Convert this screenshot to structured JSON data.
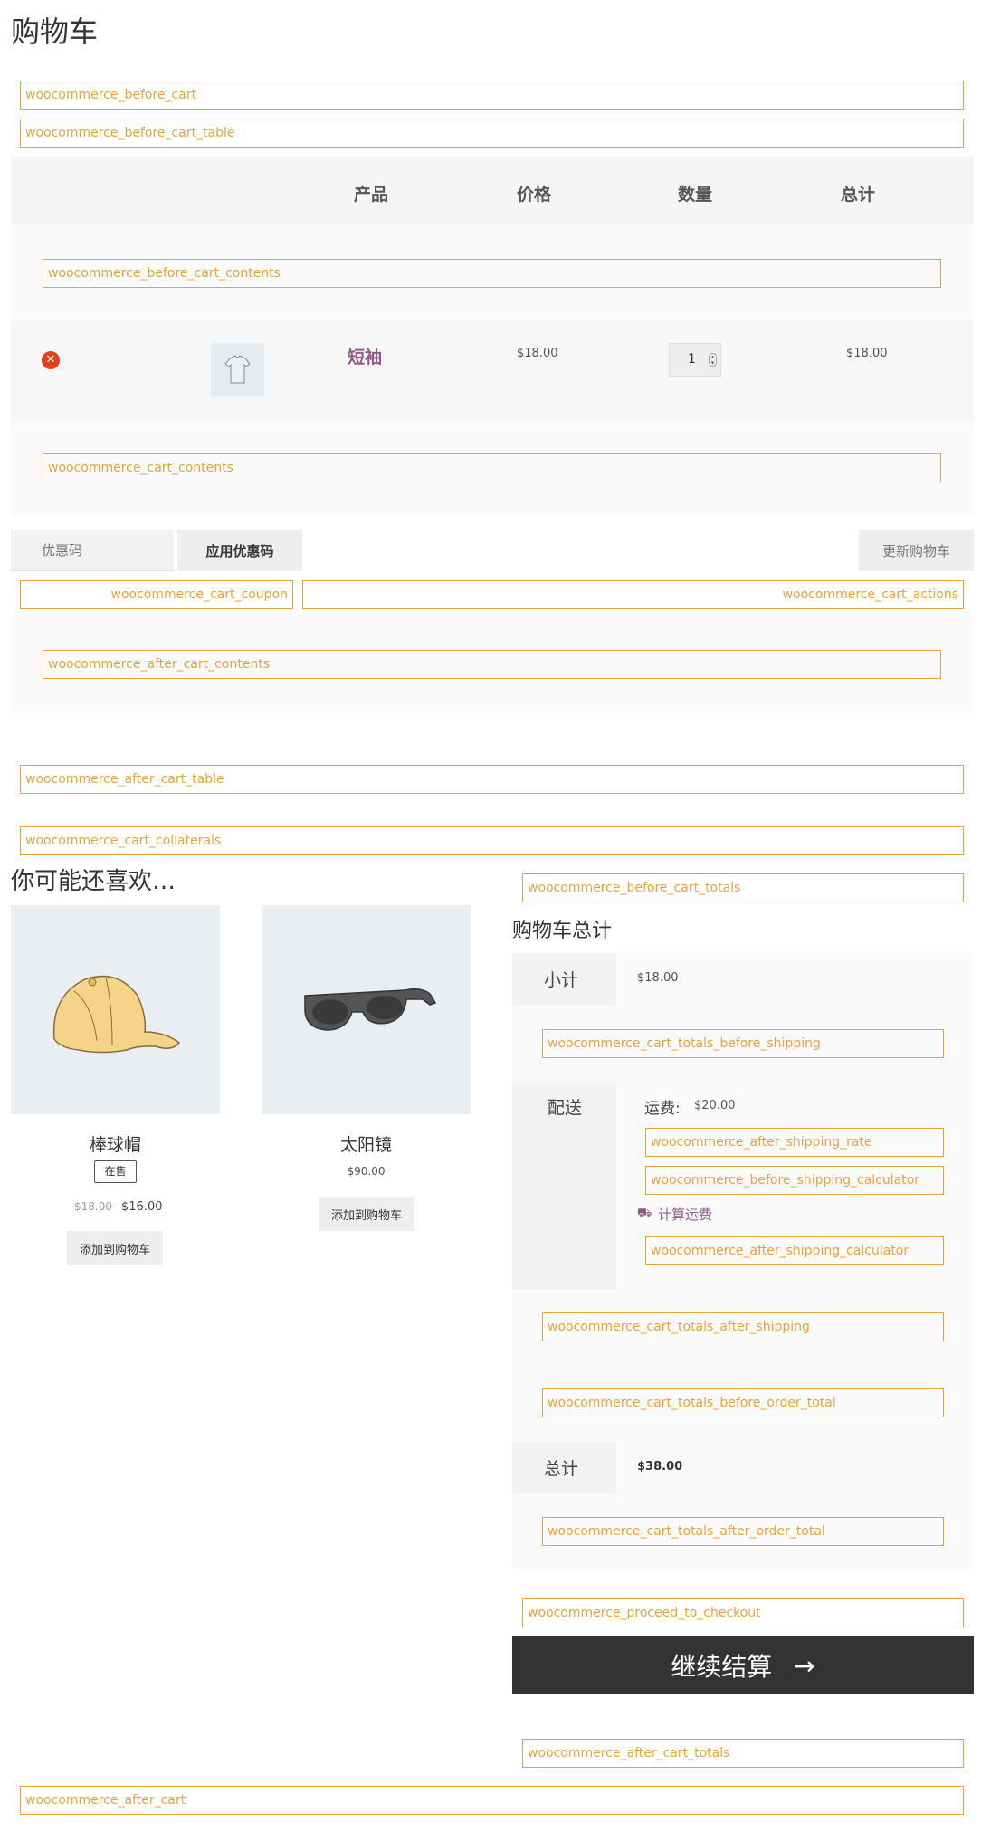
{
  "page_title": "购物车",
  "hooks": {
    "before_cart": "woocommerce_before_cart",
    "before_cart_table": "woocommerce_before_cart_table",
    "before_cart_contents": "woocommerce_before_cart_contents",
    "cart_contents": "woocommerce_cart_contents",
    "cart_coupon": "woocommerce_cart_coupon",
    "cart_actions": "woocommerce_cart_actions",
    "after_cart_contents": "woocommerce_after_cart_contents",
    "after_cart_table": "woocommerce_after_cart_table",
    "cart_collaterals": "woocommerce_cart_collaterals",
    "before_cart_totals": "woocommerce_before_cart_totals",
    "cart_totals_before_shipping": "woocommerce_cart_totals_before_shipping",
    "after_shipping_rate": "woocommerce_after_shipping_rate",
    "before_shipping_calculator": "woocommerce_before_shipping_calculator",
    "after_shipping_calculator": "woocommerce_after_shipping_calculator",
    "cart_totals_after_shipping": "woocommerce_cart_totals_after_shipping",
    "cart_totals_before_order_total": "woocommerce_cart_totals_before_order_total",
    "cart_totals_after_order_total": "woocommerce_cart_totals_after_order_total",
    "proceed_to_checkout": "woocommerce_proceed_to_checkout",
    "after_cart_totals": "woocommerce_after_cart_totals",
    "after_cart": "woocommerce_after_cart"
  },
  "table": {
    "headers": {
      "product": "产品",
      "price": "价格",
      "quantity": "数量",
      "total": "总计"
    },
    "item": {
      "name": "短袖",
      "price": "$18.00",
      "quantity": "1",
      "total": "$18.00"
    }
  },
  "coupon": {
    "placeholder": "优惠码",
    "apply_label": "应用优惠码",
    "update_label": "更新购物车"
  },
  "cross_sells": {
    "heading": "你可能还喜欢…",
    "products": [
      {
        "name": "棒球帽",
        "badge": "在售",
        "old_price": "$18.00",
        "price": "$16.00",
        "button": "添加到购物车"
      },
      {
        "name": "太阳镜",
        "price": "$90.00",
        "button": "添加到购物车"
      }
    ]
  },
  "totals": {
    "heading": "购物车总计",
    "subtotal_label": "小计",
    "subtotal_value": "$18.00",
    "shipping_label": "配送",
    "shipping_rate_label": "运费:",
    "shipping_rate_value": "$20.00",
    "calc_shipping_label": "计算运费",
    "total_label": "总计",
    "total_value": "$38.00",
    "checkout_label": "继续结算",
    "checkout_arrow": "→"
  },
  "colors": {
    "hook": "#e8a33d",
    "accent": "#96588a",
    "checkout_bg": "#333333",
    "remove": "#e2401c"
  }
}
